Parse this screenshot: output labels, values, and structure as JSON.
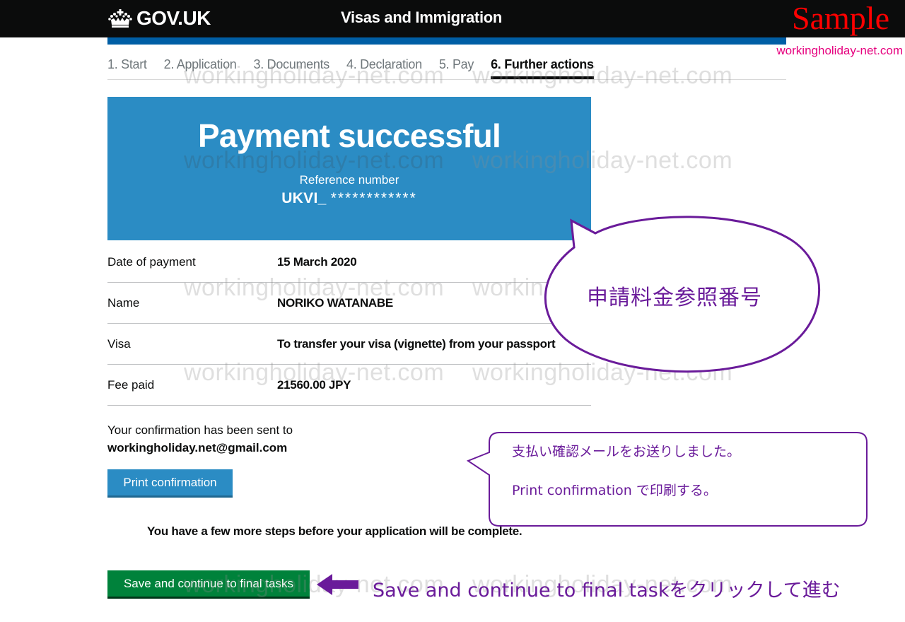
{
  "header": {
    "logo_text": "GOV.UK",
    "logo_icon": "crown-icon",
    "service_name": "Visas and Immigration",
    "sample_mark": "Sample",
    "site_url": "workingholiday-net.com"
  },
  "steps": [
    {
      "label": "1. Start",
      "active": false
    },
    {
      "label": "2. Application",
      "active": false
    },
    {
      "label": "3. Documents",
      "active": false
    },
    {
      "label": "4. Declaration",
      "active": false
    },
    {
      "label": "5. Pay",
      "active": false
    },
    {
      "label": "6. Further actions",
      "active": true
    }
  ],
  "panel": {
    "title": "Payment successful",
    "reference_label": "Reference number",
    "reference_prefix": "UKVI_",
    "reference_masked": "************"
  },
  "summary": [
    {
      "key": "Date of payment",
      "value": "15 March 2020"
    },
    {
      "key": "Name",
      "value": "NORIKO WATANABE"
    },
    {
      "key": "Visa",
      "value": "To transfer your visa (vignette) from your passport"
    },
    {
      "key": "Fee paid",
      "value": "21560.00 JPY"
    }
  ],
  "confirmation": {
    "text": "Your confirmation has been sent to",
    "email": "workingholiday.net@gmail.com",
    "print_button": "Print confirmation"
  },
  "steps_note": "You have a few more steps before your application will be complete.",
  "continue_button": "Save and continue to final tasks",
  "watermark": "workingholiday-net.com",
  "annotations": {
    "reference_callout": "申請料金参照番号",
    "email_callout_line1": "支払い確認メールをお送りしました。",
    "email_callout_line2": "Print confirmation で印刷する。",
    "continue_callout": "Save and continue to final taskをクリックして進む",
    "accent_color": "#6a1b9a"
  },
  "colors": {
    "header_bg": "#0b0c0c",
    "brand_blue": "#005ea5",
    "panel_blue": "#2b8cc4",
    "continue_green": "#00823b",
    "sample_red": "#ff0000",
    "url_pink": "#e6007e"
  }
}
